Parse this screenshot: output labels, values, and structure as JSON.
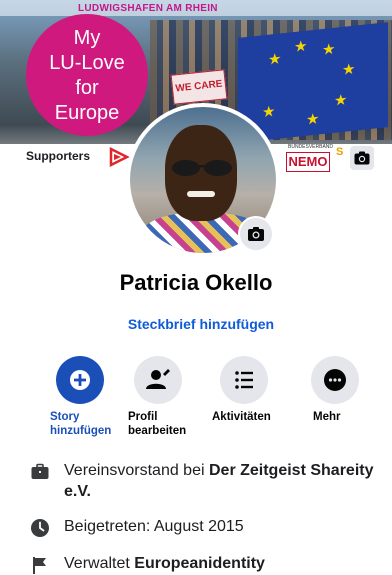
{
  "cover": {
    "city_text": "LUDWIGSHAFEN AM RHEIN",
    "slogan": [
      "My",
      "LU-Love",
      "for",
      "Europe"
    ],
    "banner_text": "WE CARE",
    "supporters_label": "Supporters",
    "nemo_small": "BUNDESVERBAND",
    "nemo_logo": "NEMO",
    "partner_mark": "S",
    "colors": {
      "brand_magenta": "#d0197f",
      "eu_blue": "#1f3fa0",
      "eu_star": "#f5d400"
    }
  },
  "profile": {
    "name": "Patricia Okello",
    "add_bio": "Steckbrief hinzufügen"
  },
  "actions": [
    {
      "line1": "Story",
      "line2": "hinzufügen",
      "icon": "plus-icon"
    },
    {
      "line1": "Profil",
      "line2": "bearbeiten",
      "icon": "edit-profile-icon"
    },
    {
      "line1": "Aktivitäten",
      "line2": "",
      "icon": "list-icon"
    },
    {
      "line1": "Mehr",
      "line2": "",
      "icon": "more-icon"
    }
  ],
  "info": [
    {
      "icon": "briefcase-icon",
      "prefix": "Vereinsvorstand bei ",
      "bold": "Der Zeitgeist Shareity e.V."
    },
    {
      "icon": "clock-icon",
      "prefix": "Beigetreten: August 2015",
      "bold": ""
    },
    {
      "icon": "flag-icon",
      "prefix": "Verwaltet ",
      "bold": "Europeanidentity"
    }
  ],
  "colors": {
    "accent_blue": "#1b4fb8",
    "link_blue": "#0f5bd8",
    "button_grey": "#e4e6eb"
  }
}
